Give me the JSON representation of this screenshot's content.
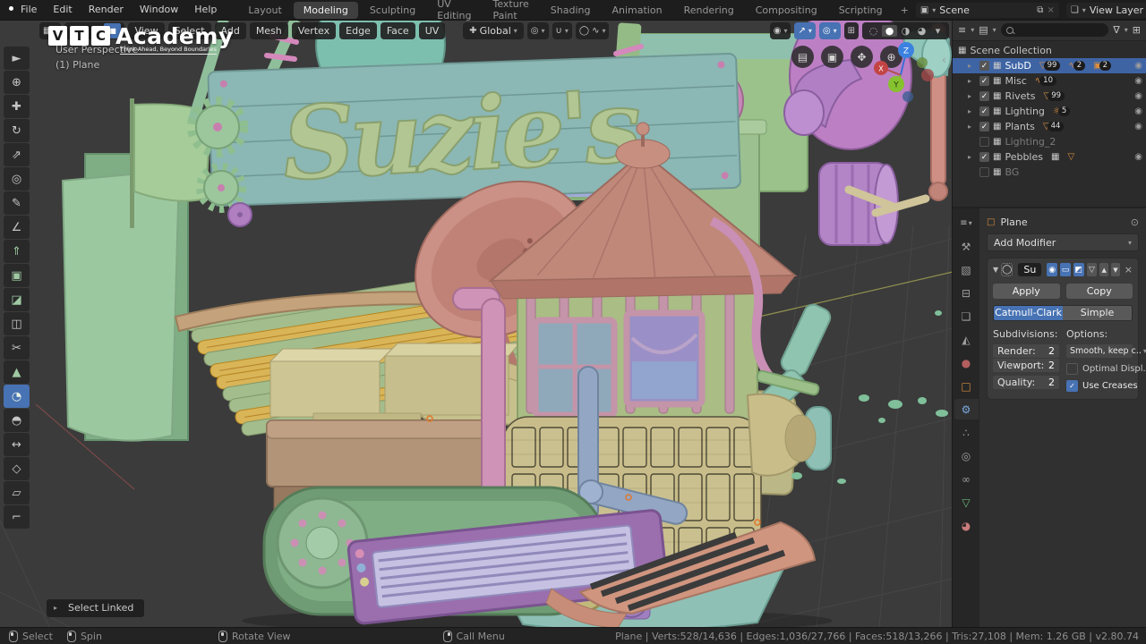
{
  "topbar": {
    "menus": [
      "File",
      "Edit",
      "Render",
      "Window",
      "Help"
    ],
    "workspaces": [
      "Layout",
      "Modeling",
      "Sculpting",
      "UV Editing",
      "Texture Paint",
      "Shading",
      "Animation",
      "Rendering",
      "Compositing",
      "Scripting"
    ],
    "active_workspace": "Modeling",
    "add_workspace": "+",
    "scene_label": "Scene",
    "view_layer_label": "View Layer"
  },
  "viewport": {
    "header": {
      "menus": [
        "View",
        "Select",
        "Add",
        "Mesh",
        "Vertex",
        "Edge",
        "Face",
        "UV"
      ],
      "orientation": "Global"
    },
    "watermark": {
      "letters": [
        "V",
        "T",
        "C"
      ],
      "word": "Academy",
      "tagline": "Think Ahead, Beyond Boundaries"
    },
    "view_label": "User Perspective",
    "object_label": "(1) Plane",
    "sign_text": "Suzie's",
    "gizmo": {
      "x": "X",
      "y": "Y",
      "z": "Z"
    },
    "operator_panel": "Select Linked"
  },
  "toolbar": {
    "active_tool": "spin",
    "tools": [
      {
        "name": "select-box",
        "glyph": "►"
      },
      {
        "name": "cursor",
        "glyph": "⊕"
      },
      {
        "name": "move",
        "glyph": "✚"
      },
      {
        "name": "rotate",
        "glyph": "↻"
      },
      {
        "name": "scale",
        "glyph": "⇗"
      },
      {
        "name": "transform",
        "glyph": "◎"
      },
      {
        "name": "annotate",
        "glyph": "✎"
      },
      {
        "name": "measure",
        "glyph": "∠"
      },
      {
        "name": "extrude-region",
        "glyph": "⇑"
      },
      {
        "name": "inset-faces",
        "glyph": "▣"
      },
      {
        "name": "bevel",
        "glyph": "◪"
      },
      {
        "name": "loop-cut",
        "glyph": "◫"
      },
      {
        "name": "knife",
        "glyph": "✂"
      },
      {
        "name": "poly-build",
        "glyph": "▲"
      },
      {
        "name": "spin",
        "glyph": "◔"
      },
      {
        "name": "smooth",
        "glyph": "◓"
      },
      {
        "name": "edge-slide",
        "glyph": "↔"
      },
      {
        "name": "shrink-fatten",
        "glyph": "◇"
      },
      {
        "name": "shear",
        "glyph": "▱"
      },
      {
        "name": "rip-region",
        "glyph": "⌐"
      }
    ]
  },
  "outliner": {
    "root": "Scene Collection",
    "items": [
      {
        "label": "SubD",
        "badges": [
          {
            "icon": "mesh",
            "count": "99"
          },
          {
            "icon": "curve",
            "count": "2"
          },
          {
            "icon": "camera",
            "count": "2"
          }
        ]
      },
      {
        "label": "Misc",
        "badges": [
          {
            "icon": "curve",
            "count": "10"
          }
        ]
      },
      {
        "label": "Rivets",
        "badges": [
          {
            "icon": "mesh",
            "count": "99"
          }
        ]
      },
      {
        "label": "Lighting",
        "badges": [
          {
            "icon": "light",
            "count": "5"
          }
        ]
      },
      {
        "label": "Plants",
        "badges": [
          {
            "icon": "mesh",
            "count": "44"
          }
        ]
      },
      {
        "label": "Lighting_2",
        "badges": []
      },
      {
        "label": "Pebbles",
        "badges": []
      },
      {
        "label": "BG",
        "badges": []
      }
    ]
  },
  "properties": {
    "breadcrumb": "Plane",
    "add_modifier": "Add Modifier",
    "modifier": {
      "name": "Su",
      "apply": "Apply",
      "copy": "Copy",
      "type_active": "Catmull-Clark",
      "type_inactive": "Simple",
      "subdivisions_label": "Subdivisions:",
      "options_label": "Options:",
      "render_label": "Render:",
      "render_value": "2",
      "viewport_label": "Viewport:",
      "viewport_value": "2",
      "quality_label": "Quality:",
      "quality_value": "2",
      "uv_smooth": "Smooth, keep c..",
      "optimal_display": "Optimal Displ..",
      "use_creases": "Use Creases"
    }
  },
  "statusbar": {
    "hint_select": "Select",
    "hint_spin": "Spin",
    "hint_rotate": "Rotate View",
    "hint_menu": "Call Menu",
    "info": "Plane | Verts:528/14,636 | Edges:1,036/27,766 | Faces:518/13,266 | Tris:27,108 | Mem: 1.26 GB | v2.80.74"
  },
  "icons": {
    "caret": "▾",
    "arrow_right": "▸",
    "check": "✓",
    "eye": "◉",
    "close": "×",
    "copy": "⧉",
    "list": "≡",
    "filter_image": "▤",
    "funnel": "∇",
    "new_collection": "⊞",
    "mode": "▦",
    "vertex": "•",
    "edge": "▬",
    "face": "■",
    "orientation": "✚",
    "pivot": "◎",
    "snap": "∪",
    "proportional": "◯",
    "falloff": "∿",
    "show_gizmo": "◉",
    "gizmo": "↗",
    "overlays": "◎",
    "xray": "⊞",
    "shade_wire": "◌",
    "shade_solid": "●",
    "shade_material": "◑",
    "shade_render": "◕",
    "scene": "▣",
    "view_layer": "❏",
    "collection": "▦",
    "mesh": "▽",
    "curve": "∿",
    "camera": "▣",
    "light": "☼",
    "nav_grid": "▤",
    "nav_cam": "▣",
    "nav_hand": "✥",
    "nav_zoom": "⊕",
    "pin": "⊙",
    "subsurf": "◯",
    "tog_cam": "◉",
    "tog_screen": "▭",
    "tog_edit": "◩",
    "tog_cage": "▽",
    "up": "▲",
    "down": "▼",
    "props_editor": "≡",
    "tab_tool": "⚒",
    "tab_render": "▧",
    "tab_output": "⊟",
    "tab_viewlayer": "❏",
    "tab_scene": "◭",
    "tab_world": "●",
    "tab_object": "□",
    "tab_modifiers": "⚙",
    "tab_particles": "∴",
    "tab_physics": "◎",
    "tab_constraints": "∞",
    "tab_data": "▽",
    "tab_material": "◕"
  },
  "colors": {
    "accent": "#4772b3",
    "selection_orange": "#e0762a",
    "badge_orange": "#d98d3e"
  }
}
